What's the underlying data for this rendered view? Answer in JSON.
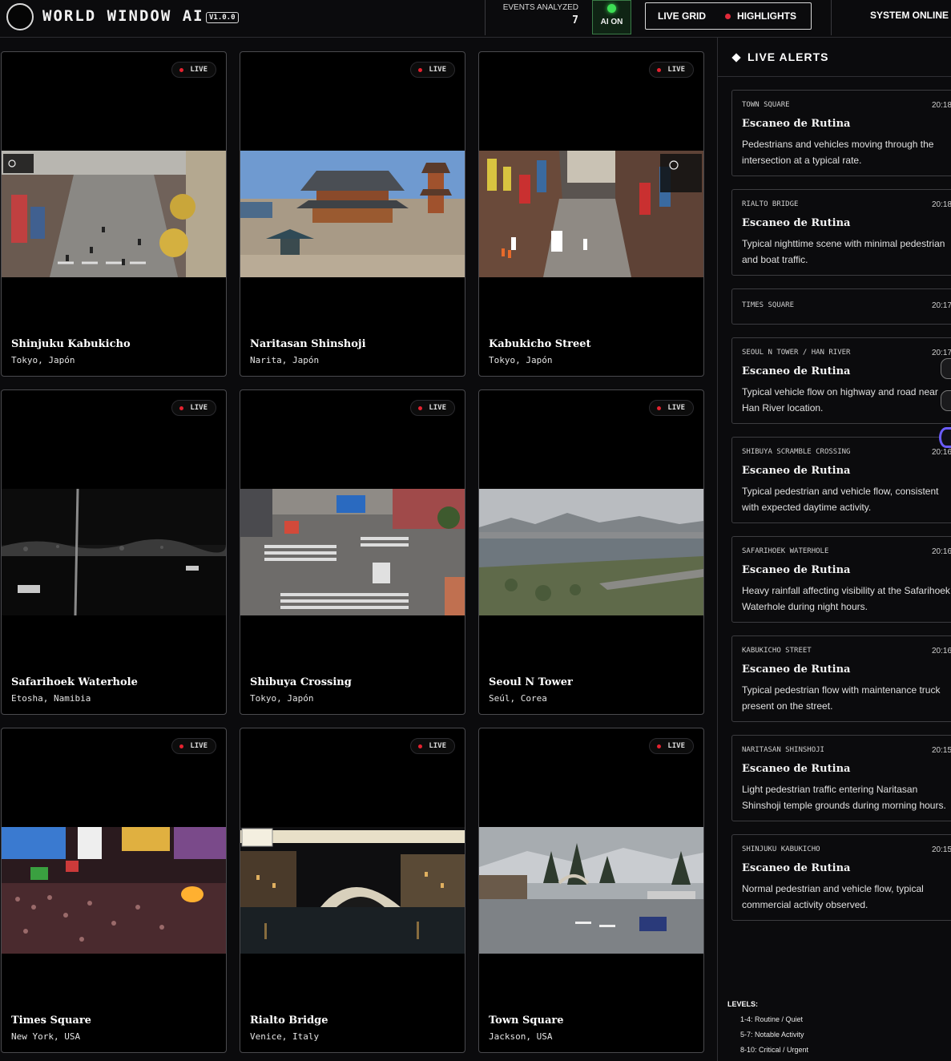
{
  "header": {
    "brand": "WORLD WINDOW AI",
    "version": "V1.0.0",
    "events_label": "EVENTS ANALYZED",
    "events_value": "7",
    "ai_label": "AI ON",
    "toggle_live": "LIVE GRID",
    "toggle_highlights": "HIGHLIGHTS",
    "system_status": "SYSTEM ONLINE"
  },
  "cameras": [
    {
      "name": "Shinjuku Kabukicho",
      "location": "Tokyo, Japón",
      "badge": "LIVE",
      "feed_icon": "street-scene"
    },
    {
      "name": "Naritasan Shinshoji",
      "location": "Narita, Japón",
      "badge": "LIVE",
      "feed_icon": "temple-scene"
    },
    {
      "name": "Kabukicho Street",
      "location": "Tokyo, Japón",
      "badge": "LIVE",
      "feed_icon": "street-scene"
    },
    {
      "name": "Safarihoek Waterhole",
      "location": "Etosha, Namibia",
      "badge": "LIVE",
      "feed_icon": "night-scene"
    },
    {
      "name": "Shibuya Crossing",
      "location": "Tokyo, Japón",
      "badge": "LIVE",
      "feed_icon": "crossing-scene"
    },
    {
      "name": "Seoul N Tower",
      "location": "Seúl, Corea",
      "badge": "LIVE",
      "feed_icon": "river-scene"
    },
    {
      "name": "Times Square",
      "location": "New York, USA",
      "badge": "LIVE",
      "feed_icon": "crowd-scene"
    },
    {
      "name": "Rialto Bridge",
      "location": "Venice, Italy",
      "badge": "LIVE",
      "feed_icon": "bridge-scene"
    },
    {
      "name": "Town Square",
      "location": "Jackson, USA",
      "badge": "LIVE",
      "feed_icon": "town-scene"
    }
  ],
  "sidebar": {
    "title": "LIVE ALERTS",
    "alerts": [
      {
        "location": "Town Square",
        "time": "20:18",
        "title": "Escaneo de Rutina",
        "desc": "Pedestrians and vehicles moving through the intersection at a typical rate."
      },
      {
        "location": "Rialto Bridge",
        "time": "20:18",
        "title": "Escaneo de Rutina",
        "desc": "Typical nighttime scene with minimal pedestrian and boat traffic."
      },
      {
        "location": "Times Square",
        "time": "20:17",
        "title": "",
        "desc": ""
      },
      {
        "location": "Seoul N Tower / Han River",
        "time": "20:17",
        "title": "Escaneo de Rutina",
        "desc": "Typical vehicle flow on highway and road near Han River location."
      },
      {
        "location": "Shibuya Scramble Crossing",
        "time": "20:16",
        "title": "Escaneo de Rutina",
        "desc": "Typical pedestrian and vehicle flow, consistent with expected daytime activity."
      },
      {
        "location": "Safarihoek Waterhole",
        "time": "20:16",
        "title": "Escaneo de Rutina",
        "desc": "Heavy rainfall affecting visibility at the Safarihoek Waterhole during night hours."
      },
      {
        "location": "Kabukicho Street",
        "time": "20:16",
        "title": "Escaneo de Rutina",
        "desc": "Typical pedestrian flow with maintenance truck present on the street."
      },
      {
        "location": "Naritasan Shinshoji",
        "time": "20:15",
        "title": "Escaneo de Rutina",
        "desc": "Light pedestrian traffic entering Naritasan Shinshoji temple grounds during morning hours."
      },
      {
        "location": "Shinjuku Kabukicho",
        "time": "20:15",
        "title": "Escaneo de Rutina",
        "desc": "Normal pedestrian and vehicle flow, typical commercial activity observed."
      }
    ],
    "levels_title": "LEVELS:",
    "levels": [
      "1-4: Routine / Quiet",
      "5-7: Notable Activity",
      "8-10: Critical / Urgent"
    ]
  },
  "colors": {
    "background": "#0b0b0d",
    "live_dot": "#e5222f",
    "ai_on": "#3ddf55",
    "accent_purple": "#6b5cff"
  }
}
